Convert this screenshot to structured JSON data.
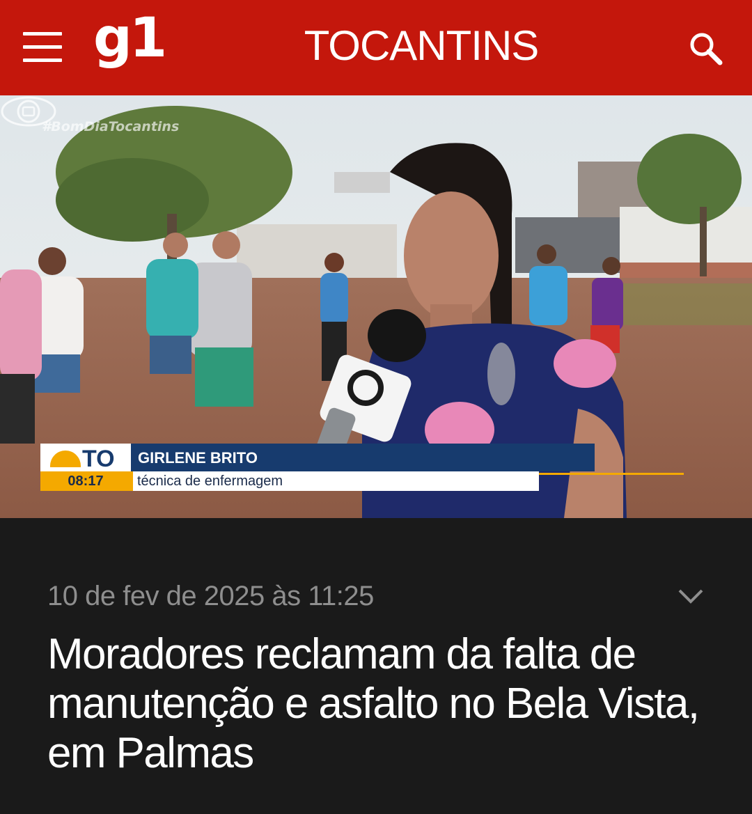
{
  "header": {
    "brand": "g1",
    "region": "TOCANTINS",
    "menu_icon": "hamburger-menu-icon",
    "search_icon": "search-icon",
    "background_color": "#c4170c"
  },
  "video": {
    "watermark": "#BomDiaTocantins",
    "lower_third": {
      "station": "TO",
      "time": "08:17",
      "name": "GIRLENE BRITO",
      "role": "técnica de enfermagem"
    }
  },
  "article": {
    "date": "10 de fev de 2025 às 11:25",
    "title": "Moradores reclamam da falta de manutenção e asfalto no Bela Vista, em Palmas",
    "expand_icon": "chevron-down-icon"
  }
}
